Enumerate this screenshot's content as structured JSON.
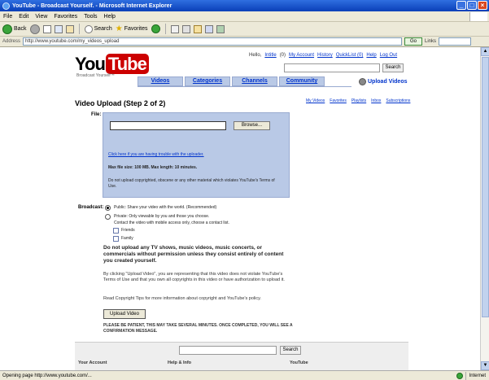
{
  "window": {
    "title": "YouTube - Broadcast Yourself. - Microsoft Internet Explorer",
    "minimize": "_",
    "maximize": "□",
    "close": "×"
  },
  "menu": [
    "File",
    "Edit",
    "View",
    "Favorites",
    "Tools",
    "Help"
  ],
  "toolbar": {
    "back": "Back",
    "search": "Search",
    "favorites": "Favorites"
  },
  "addressbar": {
    "label": "Address",
    "url": "http://www.youtube.com/my_videos_upload",
    "go": "Go",
    "links": "Links"
  },
  "page": {
    "logo_you": "You",
    "logo_tube": "Tube",
    "logo_tagline": "Broadcast Yourself™",
    "userlinks": [
      "Hello, ",
      "Intitle",
      " (0) ",
      "My Account",
      "History",
      "QuickList (0)",
      "Help",
      "Log Out"
    ],
    "search_button": "Search",
    "tabs": [
      "Videos",
      "Categories",
      "Channels",
      "Community"
    ],
    "upload_videos": "Upload Videos",
    "title": "Video Upload (Step 2 of 2)",
    "sublinks": [
      "My Videos",
      "Favorites",
      "Playlists",
      "Inbox",
      "Subscriptions"
    ],
    "file_label": "File:",
    "browse": "Browse...",
    "fb_link": "Click here if you are having trouble with the uploader.",
    "fb_limits": "Max file size: 100 MB. Max length: 10 minutes.",
    "fb_notice": "Do not upload copyrighted, obscene or any other material which violates YouTube's Terms of Use.",
    "broadcast_label": "Broadcast:",
    "opt_public": "Public: Share your video with the world. (Recommended)",
    "opt_private": "Private: Only viewable by you and those you choose.",
    "opt_private_note": "Contact the video with mobile access only, choose a contact list.",
    "friends": "Friends",
    "family": "Family",
    "warning": "Do not upload any TV shows, music videos, music concerts, or commercials without permission unless they consist entirely of content you created yourself.",
    "para1": "By clicking \"Upload Video\", you are representing that this video does not violate YouTube's Terms of Use and that you own all copyrights in this video or have authorization to upload it.",
    "para2": "Read Copyright Tips for more information about copyright and YouTube's policy.",
    "upload_button": "Upload Video",
    "caps": "PLEASE BE PATIENT, THIS MAY TAKE SEVERAL MINUTES. ONCE COMPLETED, YOU WILL SEE A CONFIRMATION MESSAGE.",
    "footer_search": "Search",
    "footer_cols": [
      "Your Account",
      "Help & Info",
      "YouTube"
    ]
  },
  "status": {
    "text": "Opening page http://www.youtube.com/...",
    "zone": "Internet"
  }
}
